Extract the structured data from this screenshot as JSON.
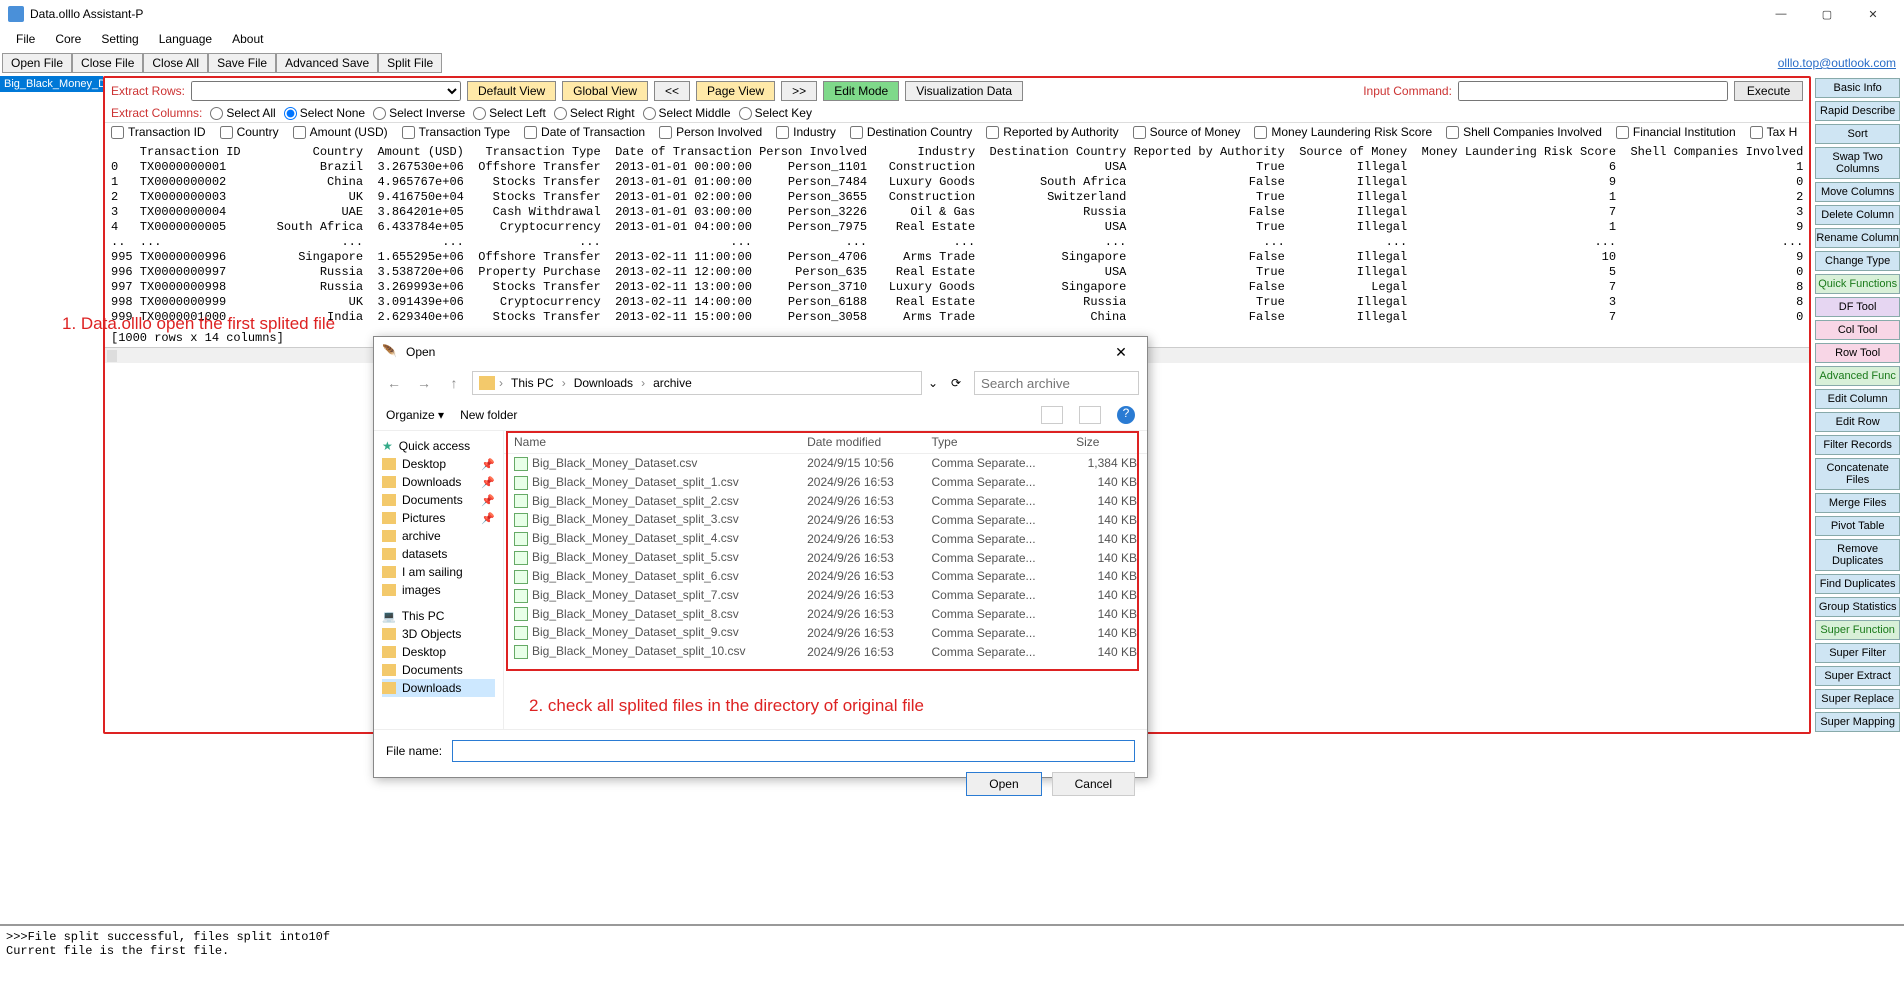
{
  "titlebar": {
    "title": "Data.olllo Assistant-P"
  },
  "menubar": [
    "File",
    "Core",
    "Setting",
    "Language",
    "About"
  ],
  "toolbar1": [
    "Open File",
    "Close File",
    "Close All",
    "Save File",
    "Advanced Save",
    "Split File"
  ],
  "email": "olllo.top@outlook.com",
  "fileTab": "Big_Black_Money_Data",
  "extractRows": {
    "label": "Extract Rows:",
    "defaultView": "Default View",
    "globalView": "Global View",
    "prev": "<<",
    "pageView": "Page View",
    "next": ">>",
    "editMode": "Edit Mode",
    "visData": "Visualization Data",
    "inputCmd": "Input Command:",
    "execute": "Execute"
  },
  "extractCols": {
    "label": "Extract Columns:",
    "opts": [
      "Select All",
      "Select None",
      "Select Inverse",
      "Select Left",
      "Select Right",
      "Select Middle",
      "Select Key"
    ],
    "selectedIdx": 1
  },
  "colChecks": [
    "Transaction ID",
    "Country",
    "Amount (USD)",
    "Transaction Type",
    "Date of Transaction",
    "Person Involved",
    "Industry",
    "Destination Country",
    "Reported by Authority",
    "Source of Money",
    "Money Laundering Risk Score",
    "Shell Companies Involved",
    "Financial Institution",
    "Tax H"
  ],
  "dataHeaders": [
    "",
    "Transaction ID",
    "Country",
    "Amount (USD)",
    "Transaction Type",
    "Date of Transaction",
    "Person Involved",
    "Industry",
    "Destination Country",
    "Reported by Authority",
    "Source of Money",
    "Money Laundering Risk Score",
    "Shell Companies Involved"
  ],
  "dataRows": [
    [
      "0",
      "TX0000000001",
      "Brazil",
      "3.267530e+06",
      "Offshore Transfer",
      "2013-01-01 00:00:00",
      "Person_1101",
      "Construction",
      "USA",
      "True",
      "Illegal",
      "6",
      "1"
    ],
    [
      "1",
      "TX0000000002",
      "China",
      "4.965767e+06",
      "Stocks Transfer",
      "2013-01-01 01:00:00",
      "Person_7484",
      "Luxury Goods",
      "South Africa",
      "False",
      "Illegal",
      "9",
      "0"
    ],
    [
      "2",
      "TX0000000003",
      "UK",
      "9.416750e+04",
      "Stocks Transfer",
      "2013-01-01 02:00:00",
      "Person_3655",
      "Construction",
      "Switzerland",
      "True",
      "Illegal",
      "1",
      "2"
    ],
    [
      "3",
      "TX0000000004",
      "UAE",
      "3.864201e+05",
      "Cash Withdrawal",
      "2013-01-01 03:00:00",
      "Person_3226",
      "Oil & Gas",
      "Russia",
      "False",
      "Illegal",
      "7",
      "3"
    ],
    [
      "4",
      "TX0000000005",
      "South Africa",
      "6.433784e+05",
      "Cryptocurrency",
      "2013-01-01 04:00:00",
      "Person_7975",
      "Real Estate",
      "USA",
      "True",
      "Illegal",
      "1",
      "9"
    ],
    [
      "..",
      "...",
      "...",
      "...",
      "...",
      "...",
      "...",
      "...",
      "...",
      "...",
      "...",
      "...",
      "..."
    ],
    [
      "995",
      "TX0000000996",
      "Singapore",
      "1.655295e+06",
      "Offshore Transfer",
      "2013-02-11 11:00:00",
      "Person_4706",
      "Arms Trade",
      "Singapore",
      "False",
      "Illegal",
      "10",
      "9"
    ],
    [
      "996",
      "TX0000000997",
      "Russia",
      "3.538720e+06",
      "Property Purchase",
      "2013-02-11 12:00:00",
      "Person_635",
      "Real Estate",
      "USA",
      "True",
      "Illegal",
      "5",
      "0"
    ],
    [
      "997",
      "TX0000000998",
      "Russia",
      "3.269993e+06",
      "Stocks Transfer",
      "2013-02-11 13:00:00",
      "Person_3710",
      "Luxury Goods",
      "Singapore",
      "False",
      "Legal",
      "7",
      "8"
    ],
    [
      "998",
      "TX0000000999",
      "UK",
      "3.091439e+06",
      "Cryptocurrency",
      "2013-02-11 14:00:00",
      "Person_6188",
      "Real Estate",
      "Russia",
      "True",
      "Illegal",
      "3",
      "8"
    ],
    [
      "999",
      "TX0000001000",
      "India",
      "2.629340e+06",
      "Stocks Transfer",
      "2013-02-11 15:00:00",
      "Person_3058",
      "Arms Trade",
      "China",
      "False",
      "Illegal",
      "7",
      "0"
    ]
  ],
  "dataFooter": "[1000 rows x 14 columns]",
  "anno1": "1. Data.olllo open the first splited file",
  "anno2": "2. check all splited files in the directory of original file",
  "sideButtons": [
    {
      "t": "Basic Info",
      "c": ""
    },
    {
      "t": "Rapid Describe",
      "c": ""
    },
    {
      "t": "Sort",
      "c": ""
    },
    {
      "t": "Swap Two Columns",
      "c": ""
    },
    {
      "t": "Move Columns",
      "c": ""
    },
    {
      "t": "Delete Column",
      "c": ""
    },
    {
      "t": "Rename Column",
      "c": ""
    },
    {
      "t": "Change Type",
      "c": ""
    },
    {
      "t": "Quick Functions",
      "c": "green"
    },
    {
      "t": "DF Tool",
      "c": "purple"
    },
    {
      "t": "Col Tool",
      "c": "pink"
    },
    {
      "t": "Row Tool",
      "c": "pink"
    },
    {
      "t": "Advanced Func",
      "c": "green"
    },
    {
      "t": "Edit Column",
      "c": ""
    },
    {
      "t": "Edit Row",
      "c": ""
    },
    {
      "t": "Filter Records",
      "c": ""
    },
    {
      "t": "Concatenate Files",
      "c": ""
    },
    {
      "t": "Merge Files",
      "c": ""
    },
    {
      "t": "Pivot Table",
      "c": ""
    },
    {
      "t": "Remove Duplicates",
      "c": ""
    },
    {
      "t": "Find Duplicates",
      "c": ""
    },
    {
      "t": "Group Statistics",
      "c": ""
    },
    {
      "t": "Super Function",
      "c": "green"
    },
    {
      "t": "Super Filter",
      "c": ""
    },
    {
      "t": "Super Extract",
      "c": ""
    },
    {
      "t": "Super Replace",
      "c": ""
    },
    {
      "t": "Super Mapping",
      "c": ""
    }
  ],
  "log": ">>>File split successful, files split into10f\nCurrent file is the first file.",
  "dialog": {
    "title": "Open",
    "breadcrumbs": [
      "This PC",
      "Downloads",
      "archive"
    ],
    "searchPlaceholder": "Search archive",
    "organize": "Organize",
    "newFolder": "New folder",
    "tree": [
      {
        "label": "Quick access",
        "ico": "star"
      },
      {
        "label": "Desktop",
        "ico": "folder",
        "pin": true
      },
      {
        "label": "Downloads",
        "ico": "folder",
        "pin": true
      },
      {
        "label": "Documents",
        "ico": "folder",
        "pin": true
      },
      {
        "label": "Pictures",
        "ico": "folder",
        "pin": true
      },
      {
        "label": "archive",
        "ico": "folder"
      },
      {
        "label": "datasets",
        "ico": "folder"
      },
      {
        "label": "I am sailing",
        "ico": "folder"
      },
      {
        "label": "images",
        "ico": "folder"
      },
      {
        "label": "This PC",
        "ico": "pc",
        "sep": true
      },
      {
        "label": "3D Objects",
        "ico": "folder"
      },
      {
        "label": "Desktop",
        "ico": "folder"
      },
      {
        "label": "Documents",
        "ico": "folder"
      },
      {
        "label": "Downloads",
        "ico": "folder",
        "sel": true
      }
    ],
    "fileCols": [
      "Name",
      "Date modified",
      "Type",
      "Size"
    ],
    "files": [
      {
        "n": "Big_Black_Money_Dataset.csv",
        "d": "2024/9/15 10:56",
        "t": "Comma Separate...",
        "s": "1,384 KB"
      },
      {
        "n": "Big_Black_Money_Dataset_split_1.csv",
        "d": "2024/9/26 16:53",
        "t": "Comma Separate...",
        "s": "140 KB"
      },
      {
        "n": "Big_Black_Money_Dataset_split_2.csv",
        "d": "2024/9/26 16:53",
        "t": "Comma Separate...",
        "s": "140 KB"
      },
      {
        "n": "Big_Black_Money_Dataset_split_3.csv",
        "d": "2024/9/26 16:53",
        "t": "Comma Separate...",
        "s": "140 KB"
      },
      {
        "n": "Big_Black_Money_Dataset_split_4.csv",
        "d": "2024/9/26 16:53",
        "t": "Comma Separate...",
        "s": "140 KB"
      },
      {
        "n": "Big_Black_Money_Dataset_split_5.csv",
        "d": "2024/9/26 16:53",
        "t": "Comma Separate...",
        "s": "140 KB"
      },
      {
        "n": "Big_Black_Money_Dataset_split_6.csv",
        "d": "2024/9/26 16:53",
        "t": "Comma Separate...",
        "s": "140 KB"
      },
      {
        "n": "Big_Black_Money_Dataset_split_7.csv",
        "d": "2024/9/26 16:53",
        "t": "Comma Separate...",
        "s": "140 KB"
      },
      {
        "n": "Big_Black_Money_Dataset_split_8.csv",
        "d": "2024/9/26 16:53",
        "t": "Comma Separate...",
        "s": "140 KB"
      },
      {
        "n": "Big_Black_Money_Dataset_split_9.csv",
        "d": "2024/9/26 16:53",
        "t": "Comma Separate...",
        "s": "140 KB"
      },
      {
        "n": "Big_Black_Money_Dataset_split_10.csv",
        "d": "2024/9/26 16:53",
        "t": "Comma Separate...",
        "s": "140 KB"
      }
    ],
    "fileNameLabel": "File name:",
    "openBtn": "Open",
    "cancelBtn": "Cancel"
  }
}
